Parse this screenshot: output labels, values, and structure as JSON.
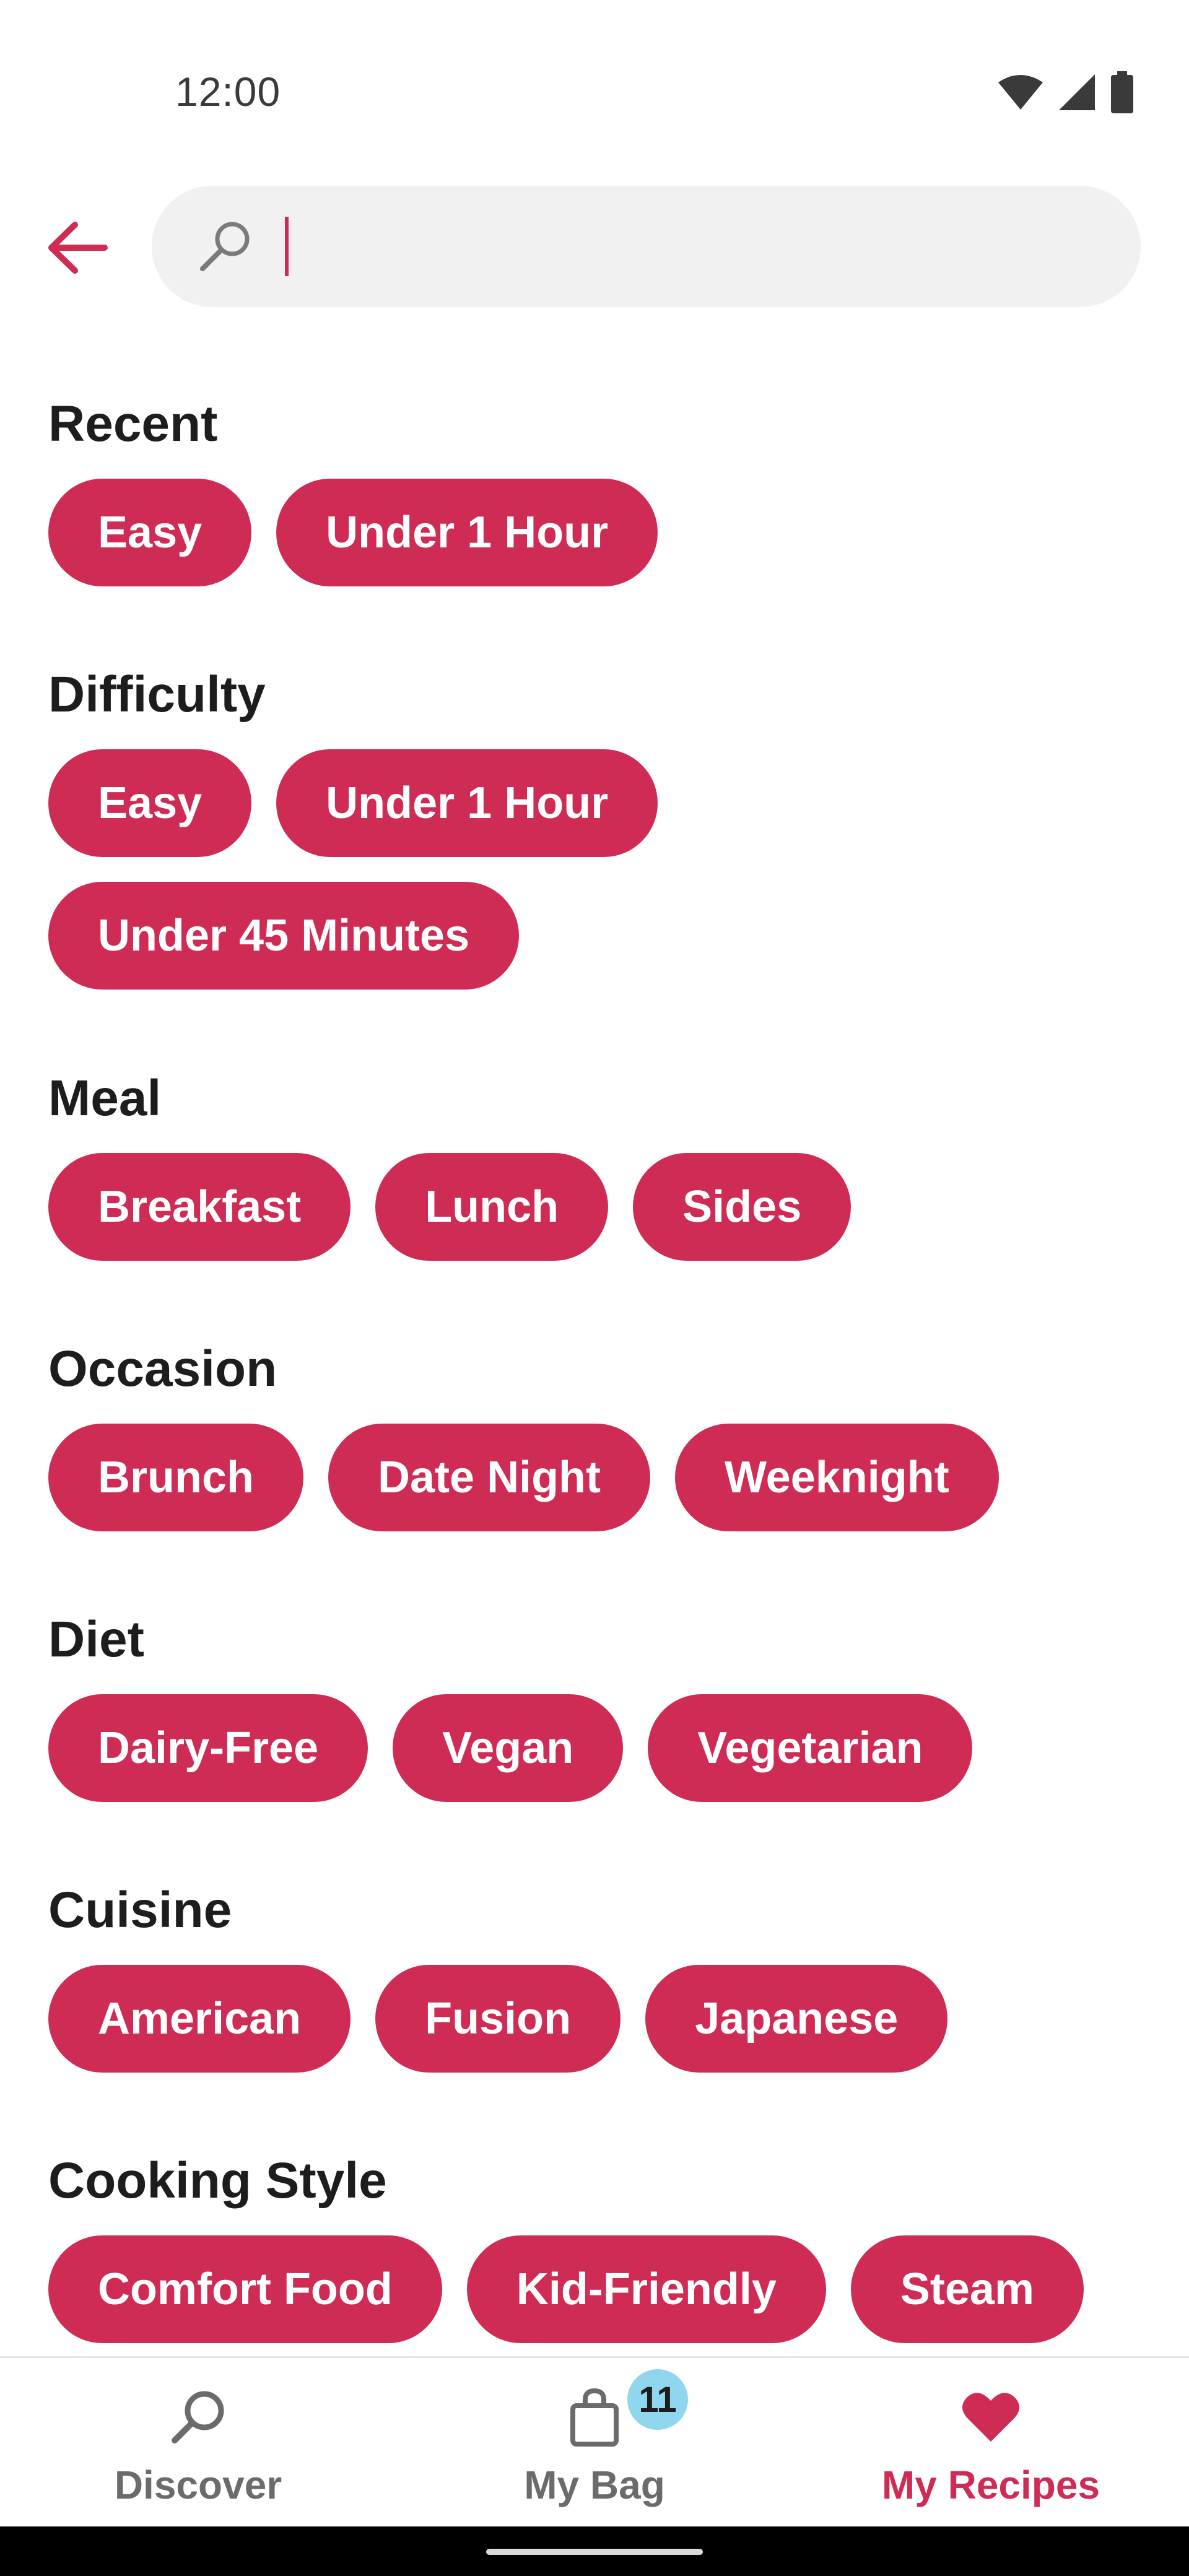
{
  "status_bar": {
    "time": "12:00",
    "icons": [
      "wifi-icon",
      "signal-icon",
      "battery-icon"
    ]
  },
  "search": {
    "placeholder": "",
    "value": ""
  },
  "sections": [
    {
      "title": "Recent",
      "chips": [
        "Easy",
        "Under 1 Hour"
      ]
    },
    {
      "title": "Difficulty",
      "chips": [
        "Easy",
        "Under 1 Hour",
        "Under 45 Minutes"
      ]
    },
    {
      "title": "Meal",
      "chips": [
        "Breakfast",
        "Lunch",
        "Sides"
      ]
    },
    {
      "title": "Occasion",
      "chips": [
        "Brunch",
        "Date Night",
        "Weeknight"
      ]
    },
    {
      "title": "Diet",
      "chips": [
        "Dairy-Free",
        "Vegan",
        "Vegetarian"
      ]
    },
    {
      "title": "Cuisine",
      "chips": [
        "American",
        "Fusion",
        "Japanese"
      ]
    },
    {
      "title": "Cooking Style",
      "chips": [
        "Comfort Food",
        "Kid-Friendly",
        "Steam"
      ]
    }
  ],
  "bottom_nav": {
    "discover": {
      "label": "Discover",
      "icon": "search-icon"
    },
    "my_bag": {
      "label": "My Bag",
      "icon": "bag-icon",
      "badge": "11"
    },
    "my_recipes": {
      "label": "My Recipes",
      "icon": "heart-icon",
      "active": true
    }
  },
  "colors": {
    "accent": "#cf2c55",
    "chip_text": "#ffffff",
    "search_bg": "#f1f1f1",
    "badge_bg": "#8fd6ee",
    "nav_inactive": "#6b6b6b"
  }
}
